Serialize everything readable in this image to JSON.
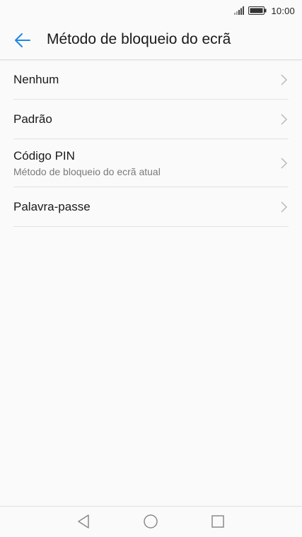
{
  "status_bar": {
    "time": "10:00",
    "icons": [
      "signal-icon",
      "battery-icon"
    ]
  },
  "app_bar": {
    "title": "Método de bloqueio do ecrã",
    "back_icon": "arrow-left-icon",
    "accent_color": "#1e88e5"
  },
  "lock_methods": [
    {
      "title": "Nenhum",
      "subtitle": ""
    },
    {
      "title": "Padrão",
      "subtitle": ""
    },
    {
      "title": "Código PIN",
      "subtitle": "Método de bloqueio do ecrã atual"
    },
    {
      "title": "Palavra-passe",
      "subtitle": ""
    }
  ],
  "nav_bar": {
    "icons": [
      "nav-back-icon",
      "nav-home-icon",
      "nav-recent-apps-icon"
    ]
  }
}
